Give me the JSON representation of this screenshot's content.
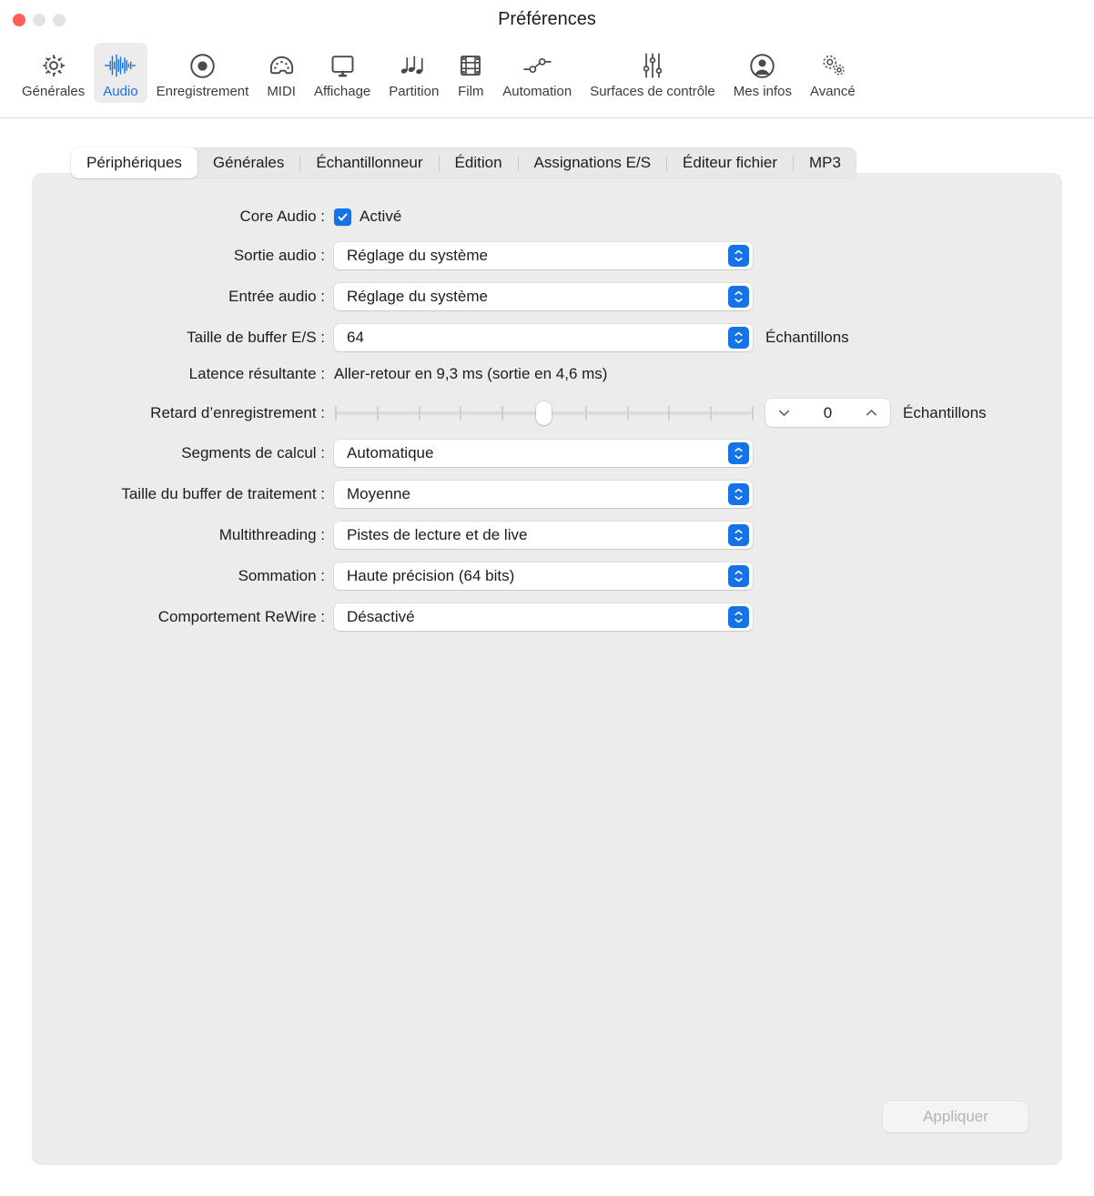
{
  "window": {
    "title": "Préférences",
    "traffic_lights": [
      "close-button",
      "minimize-button",
      "maximize-button"
    ]
  },
  "toolbar": {
    "items": [
      {
        "label": "Générales",
        "icon": "gear-icon",
        "selected": false
      },
      {
        "label": "Audio",
        "icon": "waveform-icon",
        "selected": true
      },
      {
        "label": "Enregistrement",
        "icon": "record-circle-icon",
        "selected": false
      },
      {
        "label": "MIDI",
        "icon": "midi-connector-icon",
        "selected": false
      },
      {
        "label": "Affichage",
        "icon": "display-monitor-icon",
        "selected": false
      },
      {
        "label": "Partition",
        "icon": "music-notes-icon",
        "selected": false
      },
      {
        "label": "Film",
        "icon": "film-strip-icon",
        "selected": false
      },
      {
        "label": "Automation",
        "icon": "automation-node-icon",
        "selected": false
      },
      {
        "label": "Surfaces de contrôle",
        "icon": "sliders-icon",
        "selected": false
      },
      {
        "label": "Mes infos",
        "icon": "person-circle-icon",
        "selected": false
      },
      {
        "label": "Avancé",
        "icon": "double-gear-icon",
        "selected": false
      }
    ]
  },
  "tabs": [
    {
      "label": "Périphériques",
      "active": true
    },
    {
      "label": "Générales",
      "active": false
    },
    {
      "label": "Échantillonneur",
      "active": false
    },
    {
      "label": "Édition",
      "active": false
    },
    {
      "label": "Assignations E/S",
      "active": false
    },
    {
      "label": "Éditeur fichier",
      "active": false
    },
    {
      "label": "MP3",
      "active": false
    }
  ],
  "form": {
    "core_audio": {
      "label": "Core Audio :",
      "checkbox_label": "Activé",
      "checked": true
    },
    "audio_output": {
      "label": "Sortie audio :",
      "value": "Réglage du système"
    },
    "audio_input": {
      "label": "Entrée audio :",
      "value": "Réglage du système"
    },
    "io_buffer": {
      "label": "Taille de buffer E/S :",
      "value": "64",
      "suffix": "Échantillons"
    },
    "resulting_latency": {
      "label": "Latence résultante :",
      "value": "Aller-retour en 9,3 ms (sortie en 4,6 ms)"
    },
    "recording_delay": {
      "label": "Retard d’enregistrement :",
      "value": "0",
      "suffix": "Échantillons",
      "slider_ticks": 11,
      "slider_position_index": 5
    },
    "process_buffer_segments": {
      "label": "Segments de calcul :",
      "value": "Automatique"
    },
    "process_buffer_range": {
      "label": "Taille du buffer de traitement :",
      "value": "Moyenne"
    },
    "multithreading": {
      "label": "Multithreading :",
      "value": "Pistes de lecture et de live"
    },
    "summing": {
      "label": "Sommation :",
      "value": "Haute précision (64 bits)"
    },
    "rewire": {
      "label": "Comportement ReWire :",
      "value": "Désactivé"
    }
  },
  "footer": {
    "apply_label": "Appliquer",
    "apply_enabled": false
  },
  "colors": {
    "accent": "#1473e6",
    "close": "#ff5f57",
    "panel_bg": "#ececec",
    "window_bg": "#ffffff",
    "text": "#1d1d1f",
    "disabled_text": "#b4b4b4"
  }
}
